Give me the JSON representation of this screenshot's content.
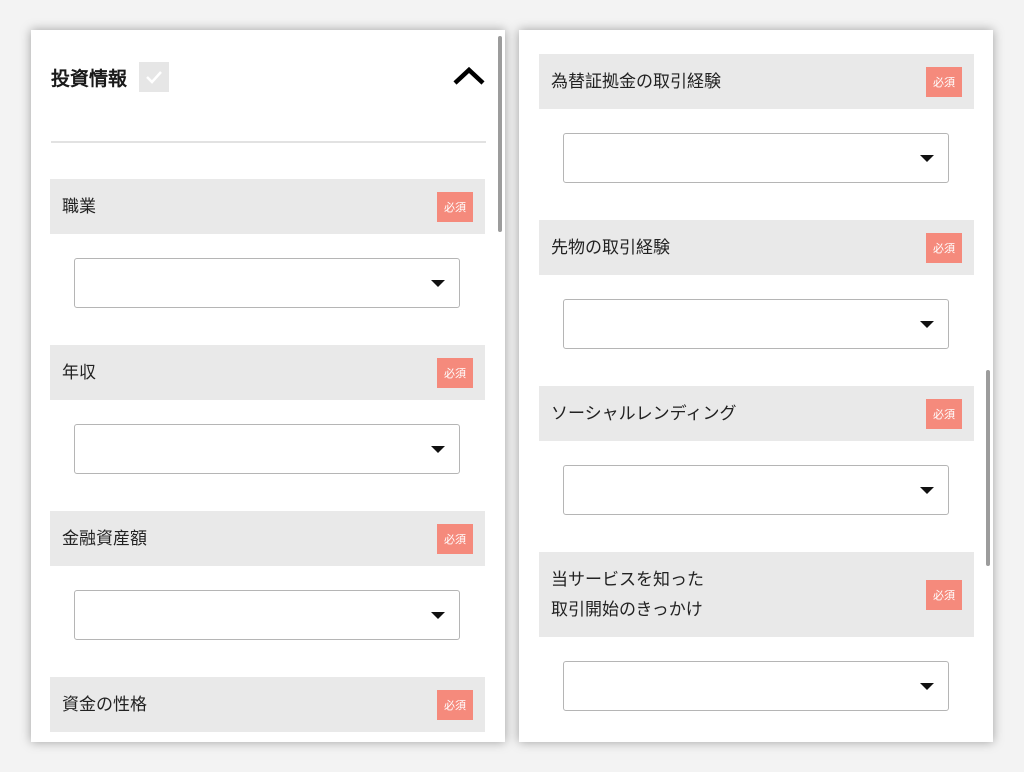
{
  "section": {
    "title": "投資情報"
  },
  "required_badge": "必須",
  "left_fields": [
    {
      "label": "職業",
      "value": ""
    },
    {
      "label": "年収",
      "value": ""
    },
    {
      "label": "金融資産額",
      "value": ""
    },
    {
      "label": "資金の性格",
      "value": ""
    }
  ],
  "right_fields": [
    {
      "label": "為替証拠金の取引経験",
      "value": ""
    },
    {
      "label": "先物の取引経験",
      "value": ""
    },
    {
      "label": "ソーシャルレンディング",
      "value": ""
    },
    {
      "label": "当サービスを知った\n取引開始のきっかけ",
      "value": ""
    }
  ],
  "colors": {
    "required_badge": "#f58a7c",
    "label_bar": "#e9e9e9",
    "check_box": "#e6e6e6"
  }
}
